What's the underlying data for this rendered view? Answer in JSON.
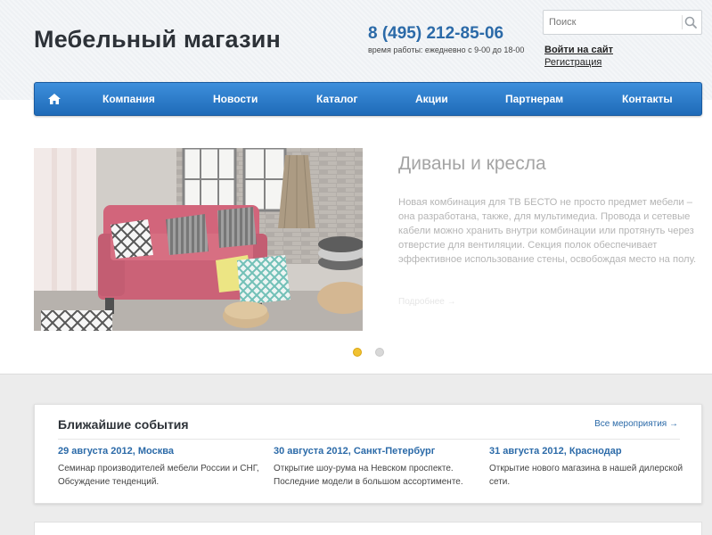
{
  "header": {
    "logo": "Мебельный магазин",
    "phone": "8 (495) 212-85-06",
    "hours": "время работы: ежедневно с 9-00 до 18-00",
    "search_placeholder": "Поиск",
    "login": "Войти на сайт",
    "register": "Регистрация"
  },
  "nav": {
    "home_icon": "home-icon",
    "items": [
      "Компания",
      "Новости",
      "Каталог",
      "Акции",
      "Партнерам",
      "Контакты"
    ]
  },
  "slider": {
    "title": "Диваны и кресла",
    "text": "Новая комбинация для ТВ БЕСТО не просто предмет мебели – она разработана, также, для мультимедиа. Провода и сетевые кабели можно хранить внутри комбинации или протянуть через отверстие для вентиляции. Секция полок обеспечивает эффективное использование стены, освобождая место на полу.",
    "more": "Подробнее →",
    "active_slide": 1,
    "slide_count": 2
  },
  "events": {
    "title": "Ближайшие события",
    "all_link": "Все мероприятия →",
    "items": [
      {
        "date": "29 августа 2012, Москва",
        "desc": "Семинар производителей мебели России и СНГ, Обсуждение тенденций."
      },
      {
        "date": "30 августа 2012, Санкт-Петербург",
        "desc": "Открытие шоу-рума на Невском проспекте. Последние модели в большом ассортименте."
      },
      {
        "date": "31 августа 2012, Краснодар",
        "desc": "Открытие нового магазина в нашей дилерской сети."
      }
    ]
  },
  "colors": {
    "accent": "#2b6aa8",
    "nav_top": "#3d8fdc",
    "nav_bottom": "#1f6bb8",
    "active_dot": "#f1c232"
  }
}
